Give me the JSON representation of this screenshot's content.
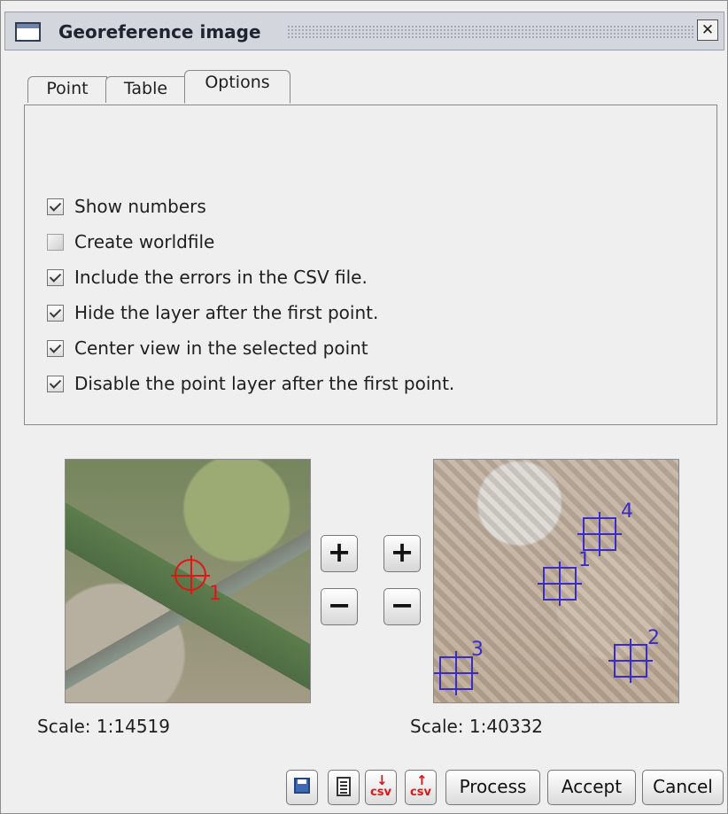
{
  "window": {
    "title": "Georeference image",
    "close_icon": "close-icon"
  },
  "tabs": [
    {
      "label": "Point"
    },
    {
      "label": "Table"
    },
    {
      "label": "Options",
      "active": true
    }
  ],
  "options": [
    {
      "label": "Show numbers",
      "checked": true
    },
    {
      "label": "Create worldfile",
      "checked": false
    },
    {
      "label": "Include the errors in the CSV file.",
      "checked": true
    },
    {
      "label": "Hide the layer after the first point.",
      "checked": true
    },
    {
      "label": "Center view in the selected point",
      "checked": true
    },
    {
      "label": "Disable the point layer after the first point.",
      "checked": true
    }
  ],
  "maps": {
    "left": {
      "scale": "Scale:  1:14519",
      "markers": [
        {
          "number": "1"
        }
      ]
    },
    "right": {
      "scale": "Scale:  1:40332",
      "markers": [
        {
          "number": "1"
        },
        {
          "number": "2"
        },
        {
          "number": "3"
        },
        {
          "number": "4"
        }
      ]
    }
  },
  "zoom": {
    "plus": "+",
    "minus": "−"
  },
  "buttons": {
    "csv": "csv",
    "process": "Process",
    "accept": "Accept",
    "cancel": "Cancel"
  }
}
